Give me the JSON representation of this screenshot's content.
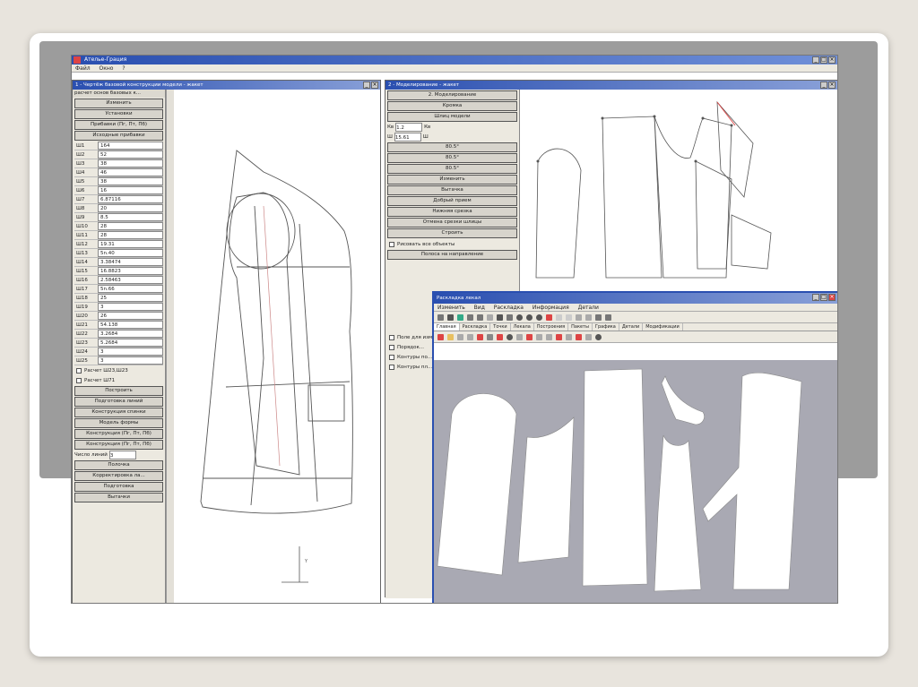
{
  "app": {
    "title": "Ателье-Грация",
    "menu": [
      "Файл",
      "Окно",
      "?"
    ]
  },
  "window_left": {
    "title": "1 - Чертёж базовой конструкции модели - жакет",
    "panel_header": "расчет основ базовых к...",
    "buttons_top": [
      "Изменить",
      "Установки",
      "Прибавки (Пг, Пт, Пб)",
      "Исходные прибавки"
    ],
    "measurements": [
      {
        "k": "Ш1",
        "v": "164"
      },
      {
        "k": "Ш2",
        "v": "52"
      },
      {
        "k": "Ш3",
        "v": "38"
      },
      {
        "k": "Ш4",
        "v": "46"
      },
      {
        "k": "Ш5",
        "v": "38"
      },
      {
        "k": "Ш6",
        "v": "16"
      },
      {
        "k": "Ш7",
        "v": "6.87116"
      },
      {
        "k": "Ш8",
        "v": "20"
      },
      {
        "k": "Ш9",
        "v": "8.5"
      },
      {
        "k": "Ш10",
        "v": "28"
      },
      {
        "k": "Ш11",
        "v": "28"
      },
      {
        "k": "Ш12",
        "v": "19.31"
      },
      {
        "k": "Ш13",
        "v": "5n.40"
      },
      {
        "k": "Ш14",
        "v": "3.38474"
      },
      {
        "k": "Ш15",
        "v": "16.8823"
      },
      {
        "k": "Ш16",
        "v": "2.58463"
      },
      {
        "k": "Ш17",
        "v": "5n.66"
      },
      {
        "k": "Ш18",
        "v": "25"
      },
      {
        "k": "Ш19",
        "v": "3"
      },
      {
        "k": "Ш20",
        "v": "26"
      },
      {
        "k": "Ш21",
        "v": "54.138"
      },
      {
        "k": "Ш22",
        "v": "3.2684"
      },
      {
        "k": "Ш23",
        "v": "5.2684"
      },
      {
        "k": "Ш24",
        "v": "3"
      },
      {
        "k": "Ш25",
        "v": "3"
      }
    ],
    "checkboxes": [
      "Расчет Ш23,Ш23",
      "Расчет Ш71"
    ],
    "buttons_bottom": [
      "Построить",
      "Подготовка линий",
      "Конструкция спинки",
      "Модель формы",
      "Конструкция (Пг, Пт, Пб)",
      "Конструкция (Пг, Пт, Пб)"
    ],
    "field_label": "Число линий",
    "field_value": "3",
    "buttons_end": [
      "Полочка",
      "Корректировка ла...",
      "Подготовка",
      "Вытачки"
    ]
  },
  "window_right": {
    "title": "2 - Моделирование - жакет",
    "buttons": [
      "2. Моделирование",
      "Кромка",
      "Шлиц модели",
      "Изменить",
      "Вытачка",
      "Добрый прием",
      "Нижняя срезка",
      "Отмена срезки шлицы",
      "Строить"
    ],
    "fields": [
      {
        "k": "Кв",
        "v": "1.2",
        "u": "Кв"
      },
      {
        "k": "Ш",
        "v": "15.61",
        "u": "Ш"
      }
    ],
    "options": [
      "80.5°",
      "80.5°",
      "80.5°"
    ],
    "checkboxes": [
      "Рисовать все объекты",
      "Полоса на направление"
    ],
    "lower_checkboxes": [
      "Поле для изм...",
      "Порядок...",
      "Контуры по...",
      "Контуры пл..."
    ]
  },
  "window_layout": {
    "title": "Раскладка лекал",
    "menu": [
      "Изменить",
      "Вид",
      "Раскладка",
      "Информация",
      "Детали"
    ],
    "tabs": [
      "Главная",
      "Раскладка",
      "Точки",
      "Лекала",
      "Построения",
      "Пакеты",
      "Графика",
      "Детали",
      "Модификации"
    ]
  },
  "colors": {
    "titlebar": "#2a4fb0",
    "workspace": "#a9a9b3",
    "panel": "#ece9e0",
    "pattern_line": "#555555",
    "accent_red": "#d44"
  }
}
